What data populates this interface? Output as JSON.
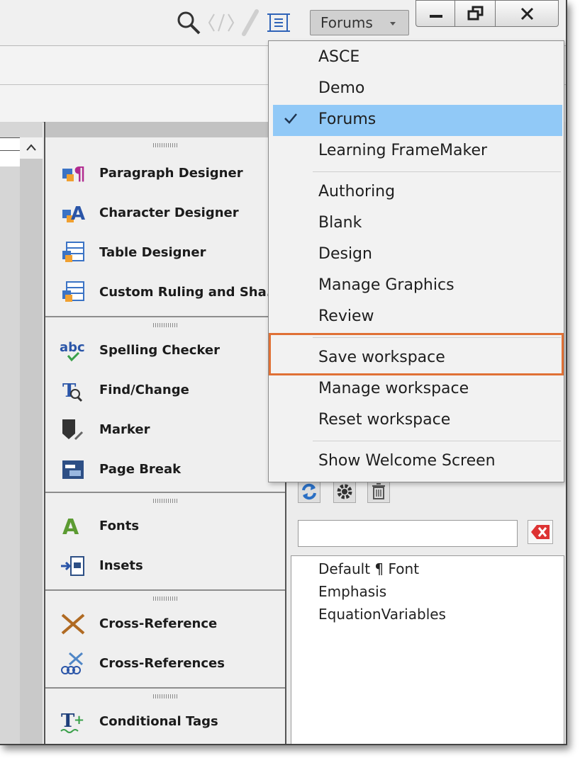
{
  "toolbar": {
    "icons": [
      "search-icon",
      "code-view-icon",
      "pen-icon",
      "frame-icon"
    ],
    "workspace_label": "Forums"
  },
  "window_controls": [
    "minimize",
    "restore",
    "close"
  ],
  "colors": {
    "accent_selection": "#91c9f7",
    "highlight_box": "#e07035"
  },
  "panel": {
    "groups": [
      {
        "items": [
          {
            "label": "Paragraph Designer",
            "icon": "paragraph-designer-icon"
          },
          {
            "label": "Character Designer",
            "icon": "character-designer-icon"
          },
          {
            "label": "Table Designer",
            "icon": "table-designer-icon"
          },
          {
            "label": "Custom Ruling and Sha...",
            "icon": "custom-ruling-icon"
          }
        ]
      },
      {
        "items": [
          {
            "label": "Spelling Checker",
            "icon": "spelling-checker-icon"
          },
          {
            "label": "Find/Change",
            "icon": "find-change-icon"
          },
          {
            "label": "Marker",
            "icon": "marker-icon"
          },
          {
            "label": "Page Break",
            "icon": "page-break-icon"
          }
        ]
      },
      {
        "items": [
          {
            "label": "Fonts",
            "icon": "fonts-icon"
          },
          {
            "label": "Insets",
            "icon": "insets-icon"
          }
        ]
      },
      {
        "items": [
          {
            "label": "Cross-Reference",
            "icon": "cross-reference-icon"
          },
          {
            "label": "Cross-References",
            "icon": "cross-references-icon"
          }
        ]
      },
      {
        "items": [
          {
            "label": "Conditional Tags",
            "icon": "conditional-tags-icon"
          }
        ]
      }
    ]
  },
  "character_catalog": {
    "tools": [
      "refresh-icon",
      "gear-icon",
      "delete-icon"
    ],
    "search_value": "",
    "items": [
      "Default ¶ Font",
      "Emphasis",
      "EquationVariables"
    ]
  },
  "workspace_menu": {
    "group1": [
      "ASCE",
      "Demo",
      "Forums",
      "Learning FrameMaker"
    ],
    "selected": "Forums",
    "group2": [
      "Authoring",
      "Blank",
      "Design",
      "Manage Graphics",
      "Review"
    ],
    "group3": [
      "Save workspace",
      "Manage workspace",
      "Reset workspace"
    ],
    "group4": [
      "Show Welcome Screen"
    ],
    "highlighted": "Save workspace"
  }
}
